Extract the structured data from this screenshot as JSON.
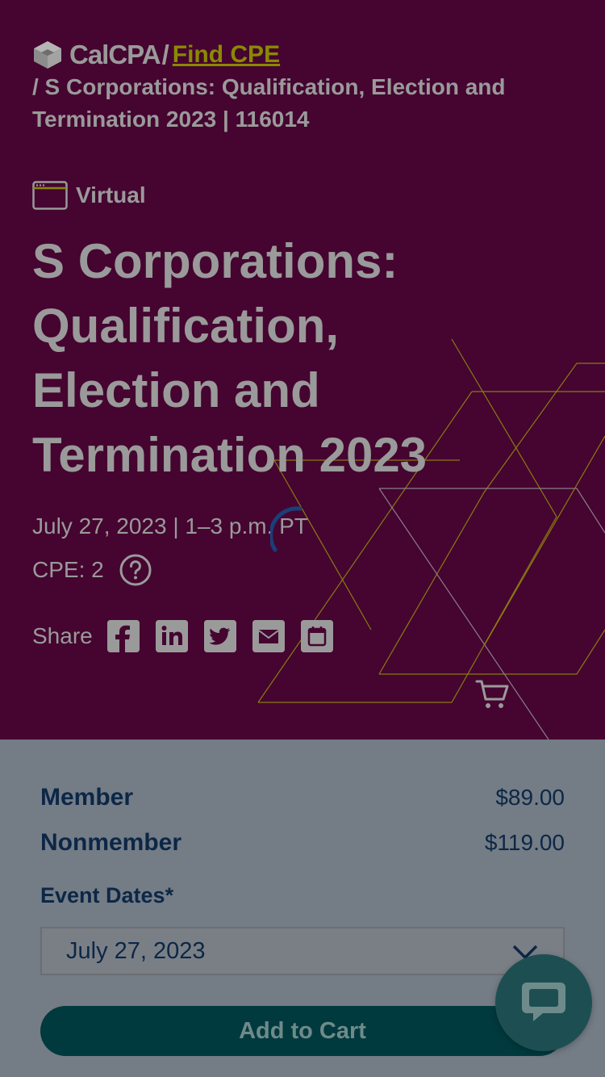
{
  "header": {
    "logo_text": "CalCPA",
    "separator": "/",
    "find_cpe_link": "Find CPE",
    "current_page": "/ S Corporations: Qualification, Election and Termination 2023 | 116014"
  },
  "event": {
    "format": "Virtual",
    "title": "S Corporations: Qualification, Election and Termination 2023",
    "date_time": "July 27, 2023 | 1–3 p.m. PT",
    "cpe": "CPE: 2"
  },
  "share": {
    "label": "Share",
    "buttons": [
      {
        "icon": "facebook-icon"
      },
      {
        "icon": "linkedin-icon"
      },
      {
        "icon": "twitter-icon"
      },
      {
        "icon": "email-icon"
      },
      {
        "icon": "calendar-icon"
      }
    ]
  },
  "pricing": {
    "member_label": "Member",
    "member_price": "$89.00",
    "nonmember_label": "Nonmember",
    "nonmember_price": "$119.00"
  },
  "registration": {
    "dates_label": "Event Dates*",
    "selected_date": "July 27, 2023",
    "add_button": "Add to Cart"
  },
  "colors": {
    "hero_bg": "#450530",
    "accent": "#8a8a00",
    "text_navy": "#0c2746",
    "button_teal": "#003a3e"
  }
}
